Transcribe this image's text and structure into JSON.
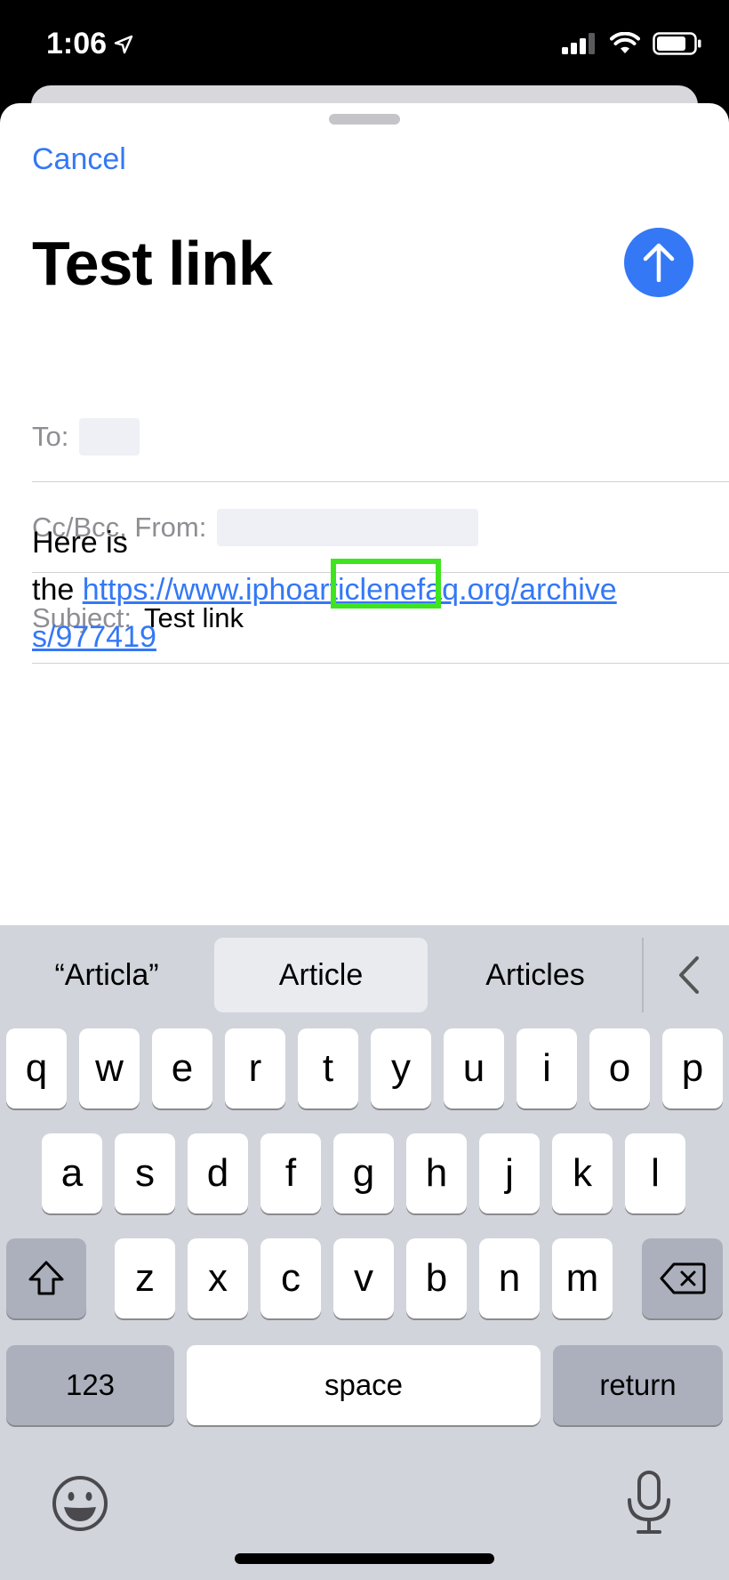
{
  "status_bar": {
    "time": "1:06"
  },
  "compose": {
    "cancel_label": "Cancel",
    "title": "Test link",
    "to_label": "To:",
    "cc_label": "Cc/Bcc, From:",
    "subject_label": "Subject:",
    "subject_value": "Test link",
    "body": {
      "line1": "Here is",
      "line2_prefix": "the ",
      "link_line2_a": "https://www.ipho",
      "link_inserted": "article",
      "link_line2_b": "nefaq.org/archive",
      "link_line3": "s/977419"
    }
  },
  "keyboard": {
    "suggestions": [
      "“Articla”",
      "Article",
      "Articles"
    ],
    "row1": [
      "q",
      "w",
      "e",
      "r",
      "t",
      "y",
      "u",
      "i",
      "o",
      "p"
    ],
    "row2": [
      "a",
      "s",
      "d",
      "f",
      "g",
      "h",
      "j",
      "k",
      "l"
    ],
    "row3": [
      "z",
      "x",
      "c",
      "v",
      "b",
      "n",
      "m"
    ],
    "numbers_label": "123",
    "space_label": "space",
    "return_label": "return",
    "icons": {
      "shift": "shift-icon",
      "delete": "delete-icon",
      "emoji": "emoji-icon",
      "mic": "microphone-icon",
      "collapse": "chevron-left-icon",
      "send": "arrow-up-icon"
    }
  },
  "colors": {
    "accent": "#3478f6",
    "highlight": "#3ee51f",
    "keyboard_bg": "#d1d4db"
  }
}
